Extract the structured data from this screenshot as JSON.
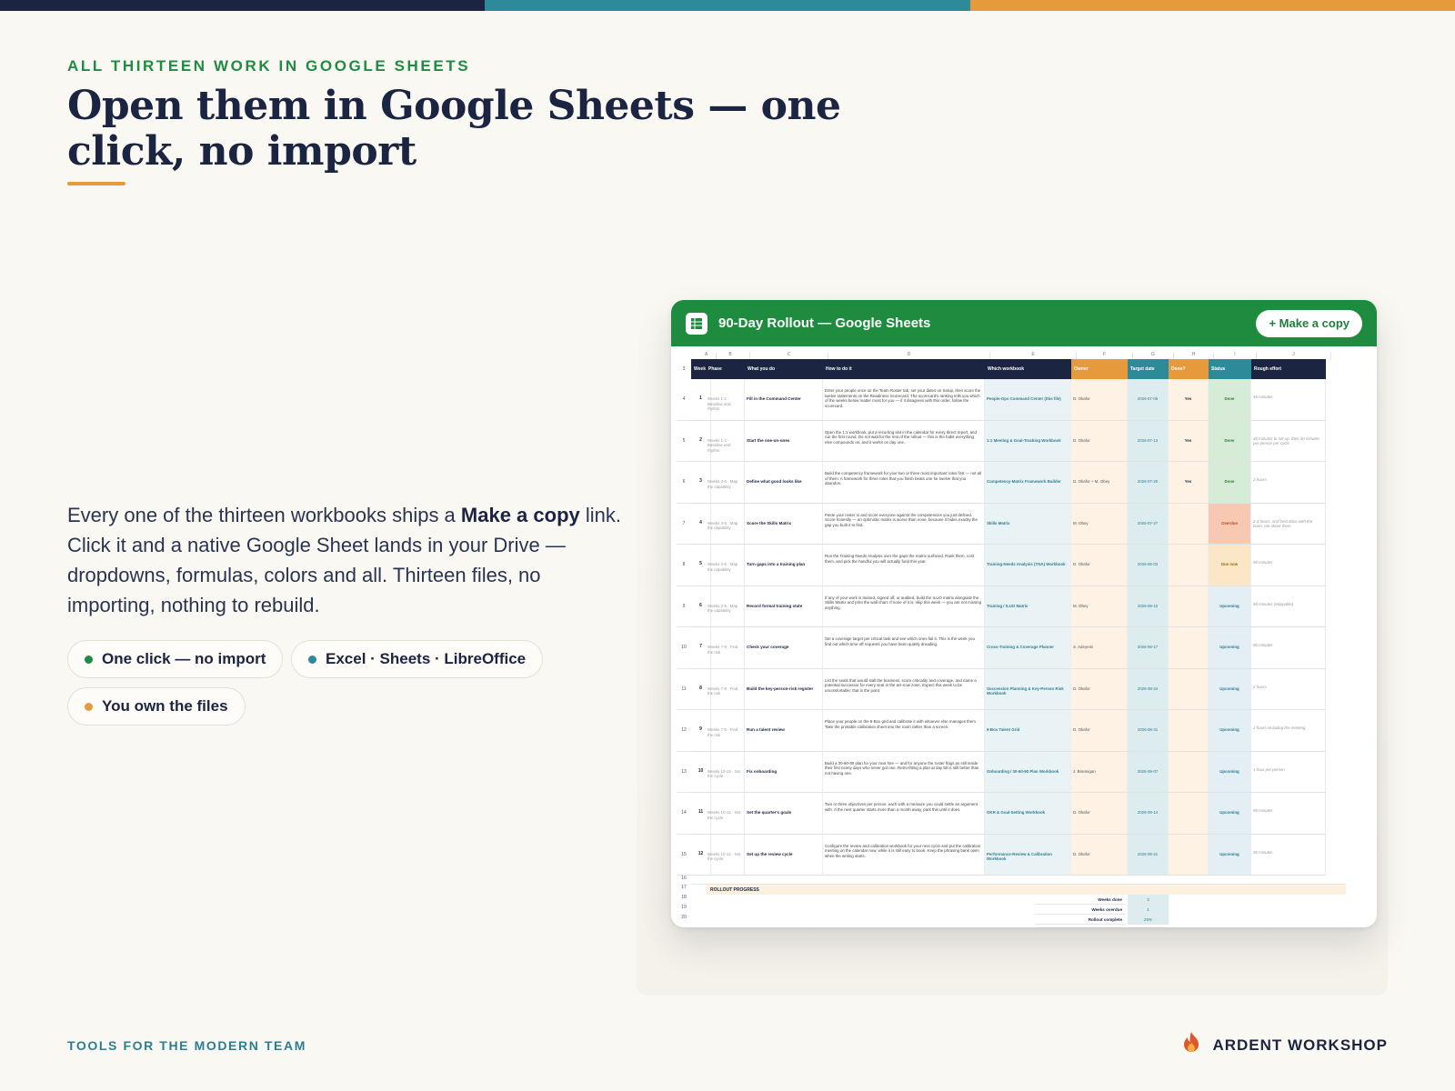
{
  "colors": {
    "navy": "#1b2440",
    "teal": "#2d8a99",
    "orange": "#e79a3c",
    "green": "#218a44",
    "sheets_green": "#1e8b3e"
  },
  "eyebrow": "ALL THIRTEEN WORK IN GOOGLE SHEETS",
  "title": "Open them in Google Sheets — one click, no import",
  "body": {
    "pre": "Every one of the thirteen workbooks ships a ",
    "bold": "Make a copy",
    "post": " link. Click it and a native Google Sheet lands in your Drive — dropdowns, formulas, colors and all. Thirteen files, no importing, nothing to rebuild."
  },
  "pills": [
    {
      "label": "One click — no import",
      "dot": "#218a44"
    },
    {
      "label": "Excel · Sheets · LibreOffice",
      "dot": "#2d8a99"
    },
    {
      "label": "You own the files",
      "dot": "#e79a3c"
    }
  ],
  "window": {
    "title": "90-Day Rollout — Google Sheets",
    "copy_button": "+ Make a copy",
    "icon": "sheets-grid-icon"
  },
  "sheet": {
    "col_letters": [
      "A",
      "B",
      "C",
      "D",
      "E",
      "F",
      "G",
      "H",
      "I",
      "J"
    ],
    "headers": [
      "Week",
      "Phase",
      "What you do",
      "How to do it",
      "Which workbook",
      "Owner",
      "Target date",
      "Done?",
      "Status",
      "Rough effort"
    ],
    "rows": [
      {
        "n": "4",
        "week": "1",
        "phase": "Weeks 1-2 · Baseline and rhythm",
        "what": "Fill in the Command Center",
        "how": "Enter your people once on the Team Roster tab, set your dates on Setup, then score the twelve statements on the Readiness Scorecard. The scorecard's ranking tells you which of the weeks below matter most for you — if it disagrees with this order, follow the scorecard.",
        "wb": "People-Ops Command Center (this file)",
        "owner": "D. Okafor",
        "date": "2026-07-06",
        "done": "Yes",
        "status": "Done",
        "effort": "45 minutes"
      },
      {
        "n": "5",
        "week": "2",
        "phase": "Weeks 1-2 · Baseline and rhythm",
        "what": "Start the one-on-ones",
        "how": "Open the 1:1 workbook, put a recurring slot in the calendar for every direct report, and run the first round. Do not wait for the rest of the rollout — this is the habit everything else compounds on, and it works on day one.",
        "wb": "1:1 Meeting & Goal-Tracking Workbook",
        "owner": "D. Okafor",
        "date": "2026-07-13",
        "done": "Yes",
        "status": "Done",
        "effort": "30 minutes to set up, then 30 minutes per person per cycle"
      },
      {
        "n": "6",
        "week": "3",
        "phase": "Weeks 3-6 · Map the capability",
        "what": "Define what good looks like",
        "how": "Build the competency framework for your two or three most important roles first — not all of them. A framework for three roles that you finish beats one for twelve that you abandon.",
        "wb": "Competency-Matrix Framework Builder",
        "owner": "D. Okafor + M. Obey",
        "date": "2026-07-20",
        "done": "Yes",
        "status": "Done",
        "effort": "2 hours"
      },
      {
        "n": "7",
        "week": "4",
        "phase": "Weeks 3-6 · Map the capability",
        "what": "Score the Skills Matrix",
        "how": "Paste your roster in and score everyone against the competencies you just defined. Score honestly — an optimistic matrix is worse than none, because it hides exactly the gap you built it to find.",
        "wb": "Skills Matrix",
        "owner": "M. Obey",
        "date": "2026-07-27",
        "done": "",
        "status": "Overdue",
        "effort": "2-3 hours, and best done with the team, not about them"
      },
      {
        "n": "8",
        "week": "5",
        "phase": "Weeks 3-6 · Map the capability",
        "what": "Turn gaps into a training plan",
        "how": "Run the Training Needs Analysis over the gaps the matrix surfaced. Rank them, cost them, and pick the handful you will actually fund this year.",
        "wb": "Training-Needs Analysis (TNA) Workbook",
        "owner": "D. Okafor",
        "date": "2026-08-03",
        "done": "",
        "status": "Due now",
        "effort": "90 minutes"
      },
      {
        "n": "9",
        "week": "6",
        "phase": "Weeks 3-6 · Map the capability",
        "what": "Record formal training state",
        "how": "If any of your work is trained, signed off, or audited, build the ILUO matrix alongside the Skills Matrix and print the wall chart. If none of it is, skip this week — you are not missing anything.",
        "wb": "Training / ILUO Matrix",
        "owner": "M. Obey",
        "date": "2026-08-10",
        "done": "",
        "status": "Upcoming",
        "effort": "90 minutes (skippable)"
      },
      {
        "n": "10",
        "week": "7",
        "phase": "Weeks 7-9 · Find the risk",
        "what": "Check your coverage",
        "how": "Set a coverage target per critical task and see which ones fail it. This is the week you find out which time-off requests you have been quietly dreading.",
        "wb": "Cross-Training & Coverage Planner",
        "owner": "S. Adeyemi",
        "date": "2026-08-17",
        "done": "",
        "status": "Upcoming",
        "effort": "90 minutes"
      },
      {
        "n": "11",
        "week": "8",
        "phase": "Weeks 7-9 · Find the risk",
        "what": "Build the key-person-risk register",
        "how": "List the seats that would stall the business, score criticality and coverage, and name a potential successor for every seat in the act-now zone. Expect this week to be uncomfortable; that is the point.",
        "wb": "Succession Planning & Key-Person Risk Workbook",
        "owner": "D. Okafor",
        "date": "2026-08-24",
        "done": "",
        "status": "Upcoming",
        "effort": "2 hours"
      },
      {
        "n": "12",
        "week": "9",
        "phase": "Weeks 7-9 · Find the risk",
        "what": "Run a talent review",
        "how": "Place your people on the 9-Box grid and calibrate it with whoever else manages them. Take the printable calibration sheet into the room rather than a screen.",
        "wb": "9-Box Talent Grid",
        "owner": "D. Okafor",
        "date": "2026-08-31",
        "done": "",
        "status": "Upcoming",
        "effort": "2 hours including the meeting"
      },
      {
        "n": "13",
        "week": "10",
        "phase": "Weeks 10-12 · Set the cycle",
        "what": "Fix onboarding",
        "how": "Build a 30-60-90 plan for your next hire — and for anyone the roster flags as still inside their first ninety days who never got one. Retro-fitting a plan at day 50 is still better than not having one.",
        "wb": "Onboarding / 30-60-90 Plan Workbook",
        "owner": "J. Brannigan",
        "date": "2026-09-07",
        "done": "",
        "status": "Upcoming",
        "effort": "1 hour per person"
      },
      {
        "n": "14",
        "week": "11",
        "phase": "Weeks 10-12 · Set the cycle",
        "what": "Set the quarter's goals",
        "how": "Two or three objectives per person, each with a measure you could settle an argument with. If the next quarter starts more than a month away, park this until it does.",
        "wb": "OKR & Goal-Setting Workbook",
        "owner": "D. Okafor",
        "date": "2026-09-14",
        "done": "",
        "status": "Upcoming",
        "effort": "90 minutes"
      },
      {
        "n": "15",
        "week": "12",
        "phase": "Weeks 10-12 · Set the cycle",
        "what": "Set up the review cycle",
        "how": "Configure the review and calibration workbook for your next cycle and put the calibration meeting on the calendar now, while it is still easy to book. Keep the phrasing bank open when the writing starts.",
        "wb": "Performance-Review & Calibration Workbook",
        "owner": "D. Okafor",
        "date": "2026-09-21",
        "done": "",
        "status": "Upcoming",
        "effort": "90 minutes"
      }
    ],
    "progress_title": "ROLLOUT PROGRESS",
    "progress": [
      {
        "n": "18",
        "label": "Weeks done",
        "value": "3"
      },
      {
        "n": "19",
        "label": "Weeks overdue",
        "value": "1"
      },
      {
        "n": "20",
        "label": "Rollout complete",
        "value": "25%"
      }
    ]
  },
  "footer": {
    "tagline": "TOOLS FOR THE MODERN TEAM",
    "brand": "ARDENT WORKSHOP",
    "brand_icon": "flame-logo-icon"
  }
}
